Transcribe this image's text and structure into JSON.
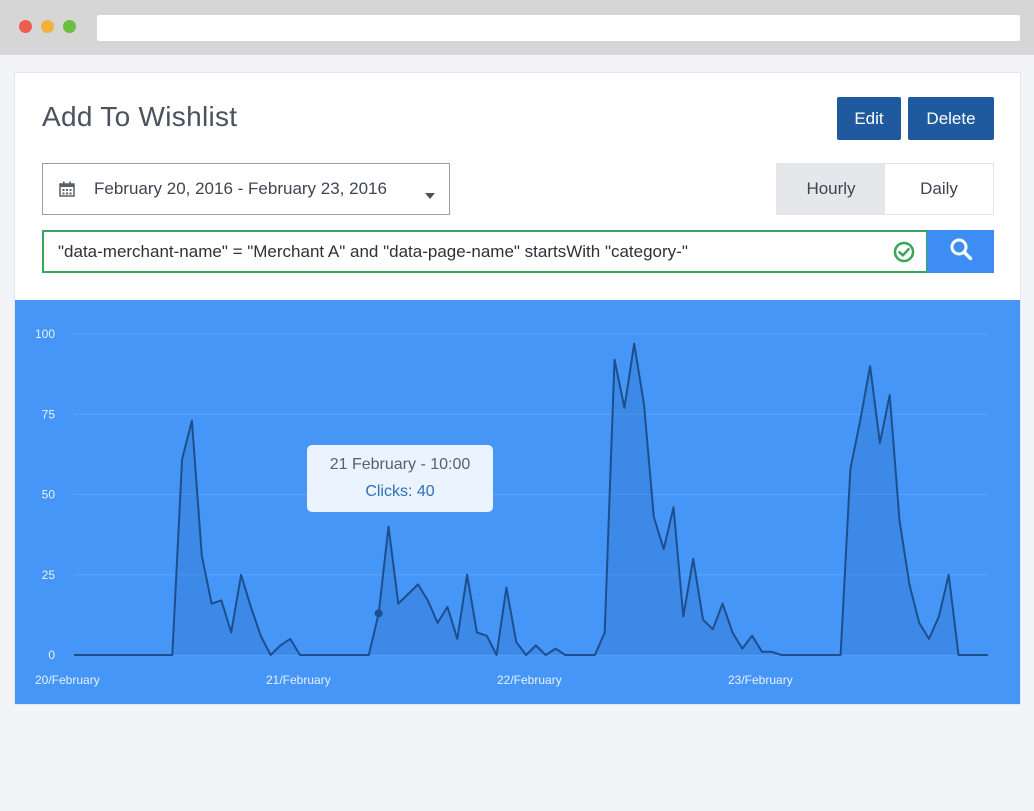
{
  "page": {
    "title": "Add To Wishlist",
    "edit_label": "Edit",
    "delete_label": "Delete"
  },
  "filters": {
    "date_range": "February 20, 2016 - February 23, 2016",
    "granularity": [
      {
        "label": "Hourly",
        "active": true
      },
      {
        "label": "Daily",
        "active": false
      }
    ],
    "query": "\"data-merchant-name\" = \"Merchant A\" and \"data-page-name\" startsWith \"category-\""
  },
  "icons": {
    "calendar": "calendar-icon",
    "caret": "caret-down-icon",
    "valid": "check-circle-icon",
    "search": "search-icon"
  },
  "colors": {
    "accent_dark": "#1f5a9e",
    "accent": "#3d8df5",
    "chart_bg": "#4696f8",
    "valid": "#3ca35a"
  },
  "tooltip": {
    "title": "21 February - 10:00",
    "value": "Clicks: 40"
  },
  "chart_data": {
    "type": "area",
    "y_ticks": [
      "0",
      "25",
      "50",
      "75",
      "100"
    ],
    "ylim": [
      0,
      100
    ],
    "x_labels": [
      "20/February",
      "21/February",
      "22/February",
      "23/February"
    ],
    "grid": true,
    "highlight_index": 31,
    "series": [
      {
        "values": [
          0,
          0,
          0,
          0,
          0,
          0,
          0,
          0,
          0,
          0,
          0,
          61,
          73,
          31,
          16,
          17,
          7,
          25,
          15,
          6,
          0,
          3,
          5,
          0,
          0,
          0,
          0,
          0,
          0,
          0,
          0,
          13,
          40,
          16,
          19,
          22,
          17,
          10,
          15,
          5,
          25,
          7,
          6,
          0,
          21,
          4,
          0,
          3,
          0,
          2,
          0,
          0,
          0,
          0,
          7,
          92,
          77,
          97,
          78,
          43,
          33,
          46,
          12,
          30,
          11,
          8,
          16,
          7,
          2,
          6,
          1,
          1,
          0,
          0,
          0,
          0,
          0,
          0,
          0,
          58,
          73,
          90,
          66,
          81,
          42,
          22,
          10,
          5,
          12,
          25,
          0,
          0,
          0,
          0
        ]
      }
    ]
  }
}
